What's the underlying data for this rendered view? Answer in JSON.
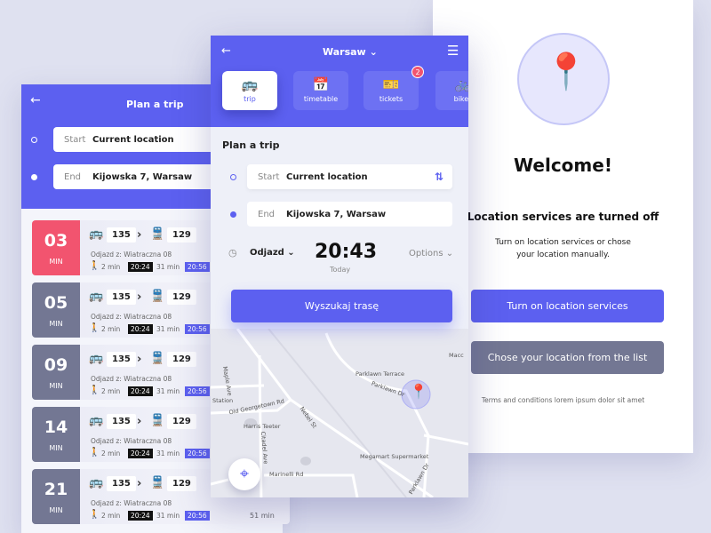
{
  "colors": {
    "primary": "#5c60f0",
    "urgent": "#f2546f",
    "grey": "#737793"
  },
  "left": {
    "title": "Plan a trip",
    "start_label": "Start",
    "start_value": "Current location",
    "end_label": "End",
    "end_value": "Kijowska 7, Warsaw",
    "rows": [
      {
        "minutes": "03",
        "unit": "MIN",
        "line1": "135",
        "line2": "129",
        "departure": "Odjazd z: Wiatraczna 08",
        "walk": "2 min",
        "t1": "20:24",
        "ride": "31 min",
        "t2": "20:56",
        "total": ""
      },
      {
        "minutes": "05",
        "unit": "MIN",
        "line1": "135",
        "line2": "129",
        "departure": "Odjazd z: Wiatraczna 08",
        "walk": "2 min",
        "t1": "20:24",
        "ride": "31 min",
        "t2": "20:56",
        "total": ""
      },
      {
        "minutes": "09",
        "unit": "MIN",
        "line1": "135",
        "line2": "129",
        "departure": "Odjazd z: Wiatraczna 08",
        "walk": "2 min",
        "t1": "20:24",
        "ride": "31 min",
        "t2": "20:56",
        "total": ""
      },
      {
        "minutes": "14",
        "unit": "MIN",
        "line1": "135",
        "line2": "129",
        "departure": "Odjazd z: Wiatraczna 08",
        "walk": "2 min",
        "t1": "20:24",
        "ride": "31 min",
        "t2": "20:56",
        "total": ""
      },
      {
        "minutes": "21",
        "unit": "MIN",
        "line1": "135",
        "line2": "129",
        "departure": "Odjazd z: Wiatraczna 08",
        "walk": "2 min",
        "t1": "20:24",
        "ride": "31 min",
        "t2": "20:56",
        "total": "51 min"
      }
    ]
  },
  "mid": {
    "city": "Warsaw",
    "tabs": [
      {
        "label": "trip",
        "icon": "bus-icon"
      },
      {
        "label": "timetable",
        "icon": "calendar-icon"
      },
      {
        "label": "tickets",
        "icon": "ticket-icon",
        "badge": "2"
      },
      {
        "label": "bikes",
        "icon": "bike-icon"
      }
    ],
    "title": "Plan a trip",
    "start_label": "Start",
    "start_value": "Current location",
    "end_label": "End",
    "end_value": "Kijowska 7, Warsaw",
    "mode": "Odjazd",
    "time": "20:43",
    "day": "Today",
    "options": "Options",
    "search": "Wyszukaj trasę",
    "map_labels": [
      "Parklawn Terrace",
      "Parklawn Dr",
      "Maple Ave",
      "Station",
      "Old Georgetown Rd",
      "Harris Teeter",
      "Nebel St",
      "Citadel Ave",
      "Megamart Supermarket",
      "Marinelli Rd",
      "Parklawn Dr",
      "Macc"
    ]
  },
  "right": {
    "title": "Welcome!",
    "subtitle": "Location services are turned off",
    "text1": "Turn on location services or chose",
    "text2": "your location manually.",
    "primary_button": "Turn on location services",
    "secondary_button": "Chose your location from the list",
    "terms": "Terms and conditions lorem ipsum dolor sit amet"
  }
}
